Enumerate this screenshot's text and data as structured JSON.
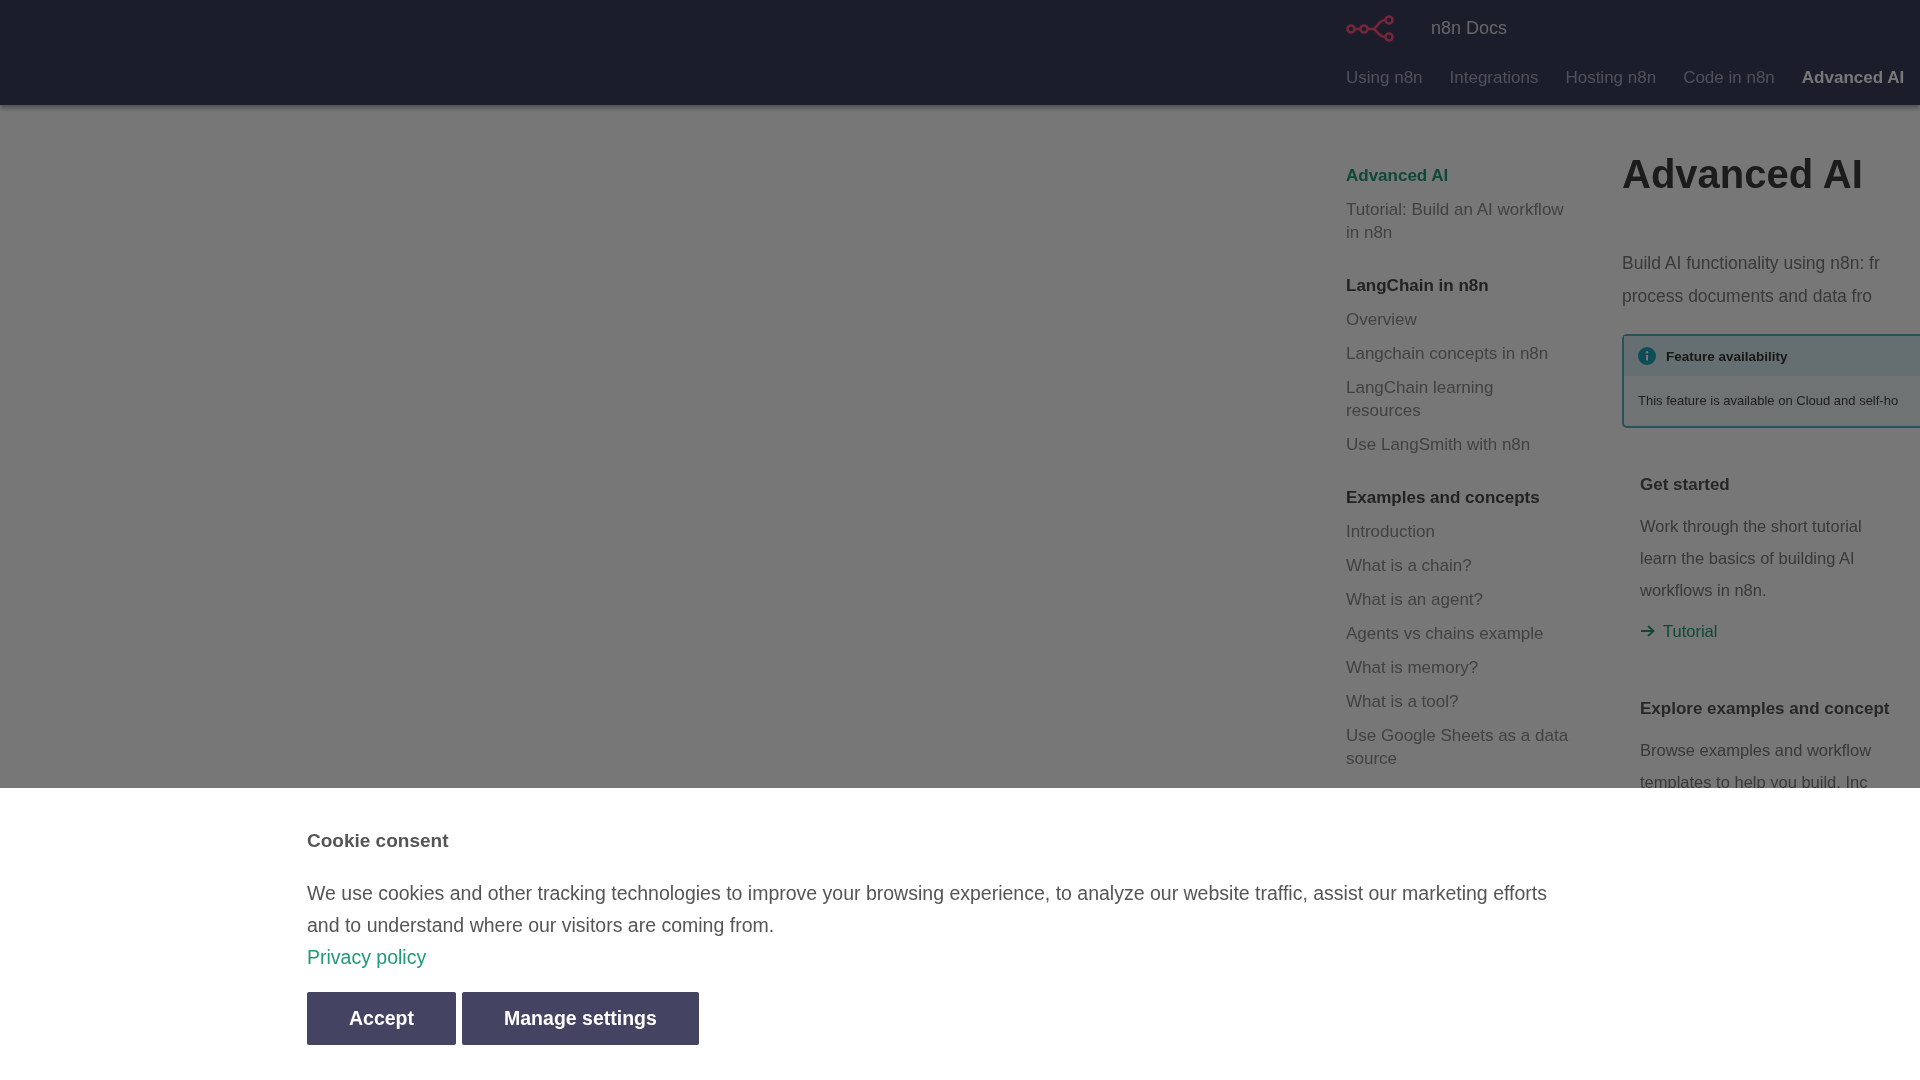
{
  "header": {
    "title": "n8n Docs",
    "tabs": [
      {
        "label": "Using n8n",
        "selected": false
      },
      {
        "label": "Integrations",
        "selected": false
      },
      {
        "label": "Hosting n8n",
        "selected": false
      },
      {
        "label": "Code in n8n",
        "selected": false
      },
      {
        "label": "Advanced AI",
        "selected": true
      }
    ]
  },
  "sidebar": {
    "items": [
      {
        "label": "Advanced AI",
        "kind": "link",
        "selected": true
      },
      {
        "label": "Tutorial: Build an AI workflow in n8n",
        "kind": "link",
        "selected": false
      },
      {
        "label": "LangChain in n8n",
        "kind": "heading",
        "selected": false
      },
      {
        "label": "Overview",
        "kind": "link",
        "selected": false
      },
      {
        "label": "Langchain concepts in n8n",
        "kind": "link",
        "selected": false
      },
      {
        "label": "LangChain learning resources",
        "kind": "link",
        "selected": false
      },
      {
        "label": "Use LangSmith with n8n",
        "kind": "link",
        "selected": false
      },
      {
        "label": "Examples and concepts",
        "kind": "heading",
        "selected": false
      },
      {
        "label": "Introduction",
        "kind": "link",
        "selected": false
      },
      {
        "label": "What is a chain?",
        "kind": "link",
        "selected": false
      },
      {
        "label": "What is an agent?",
        "kind": "link",
        "selected": false
      },
      {
        "label": "Agents vs chains example",
        "kind": "link",
        "selected": false
      },
      {
        "label": "What is memory?",
        "kind": "link",
        "selected": false
      },
      {
        "label": "What is a tool?",
        "kind": "link",
        "selected": false
      },
      {
        "label": "Use Google Sheets as a data source",
        "kind": "link",
        "selected": false
      }
    ]
  },
  "content": {
    "title": "Advanced AI",
    "intro_lines": [
      "Build AI functionality using n8n: fr",
      "process documents and data fro"
    ],
    "callout": {
      "title": "Feature availability",
      "text": "This feature is available on Cloud and self-ho"
    },
    "cards": [
      {
        "title": "Get started",
        "text_lines": [
          "Work through the short tutorial",
          "learn the basics of building AI",
          "workflows in n8n."
        ],
        "link": "Tutorial"
      },
      {
        "title": "Explore examples and concept",
        "text_lines": [
          "Browse examples and workflow",
          "templates to help you build. Inc"
        ]
      }
    ]
  },
  "cookie_banner": {
    "title": "Cookie consent",
    "text": "We use cookies and other tracking technologies to improve your browsing experience, to analyze our website traffic, assist our marketing efforts and to understand where our visitors are coming from.",
    "link": "Privacy policy",
    "buttons": [
      "Accept",
      "Manage settings"
    ]
  }
}
